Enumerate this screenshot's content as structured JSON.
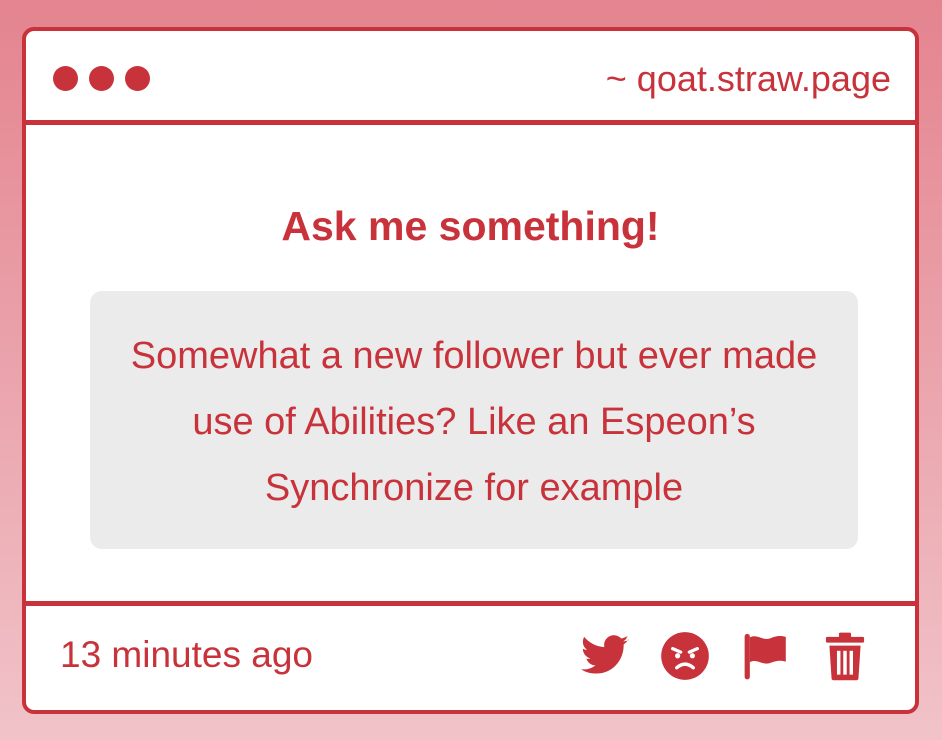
{
  "window": {
    "url": "~ qoat.straw.page"
  },
  "question": {
    "heading": "Ask me something!",
    "text": "Somewhat a new follower but ever made use of Abilities? Like an Espeon’s Synchronize for example"
  },
  "footer": {
    "timestamp": "13 minutes ago",
    "actions": [
      {
        "icon": "twitter-icon"
      },
      {
        "icon": "angry-face-icon"
      },
      {
        "icon": "flag-icon"
      },
      {
        "icon": "trash-icon"
      }
    ]
  },
  "colors": {
    "accent": "#c8323a",
    "question_bg": "#ebebeb",
    "background_top": "#e4848f",
    "background_bottom": "#f1c3c9"
  }
}
